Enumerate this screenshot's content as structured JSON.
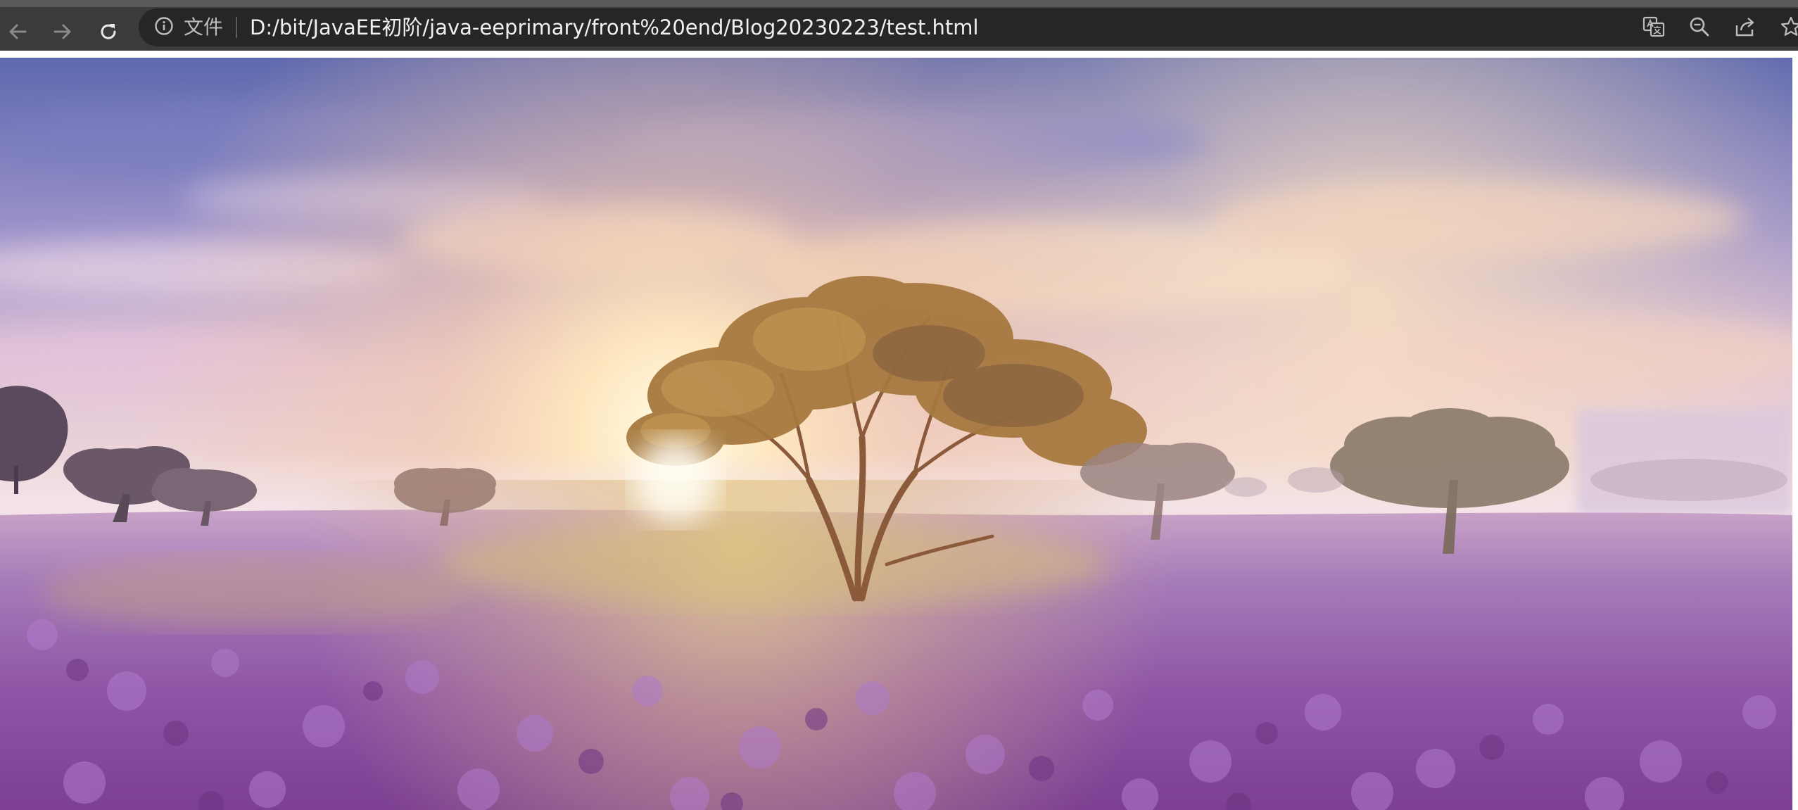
{
  "browser": {
    "site_info_label": "文件",
    "address_url": "D:/bit/JavaEE初阶/java-eeprimary/front%20end/Blog20230223/test.html",
    "nav_icons": [
      "back-arrow-icon",
      "forward-arrow-icon",
      "reload-icon"
    ],
    "right_icons": [
      "translate-icon",
      "zoom-out-icon",
      "share-icon",
      "bookmark-star-icon"
    ]
  },
  "page": {
    "image_subject": "landscape-photo"
  },
  "colors": {
    "toolbar_bg": "#3b3b3b",
    "omnibox_bg": "#262626",
    "url_text": "#f0f0f0",
    "sky_top": "#6c76b6",
    "sky_glow": "#fde7c4",
    "heather": "#9a63b5"
  }
}
